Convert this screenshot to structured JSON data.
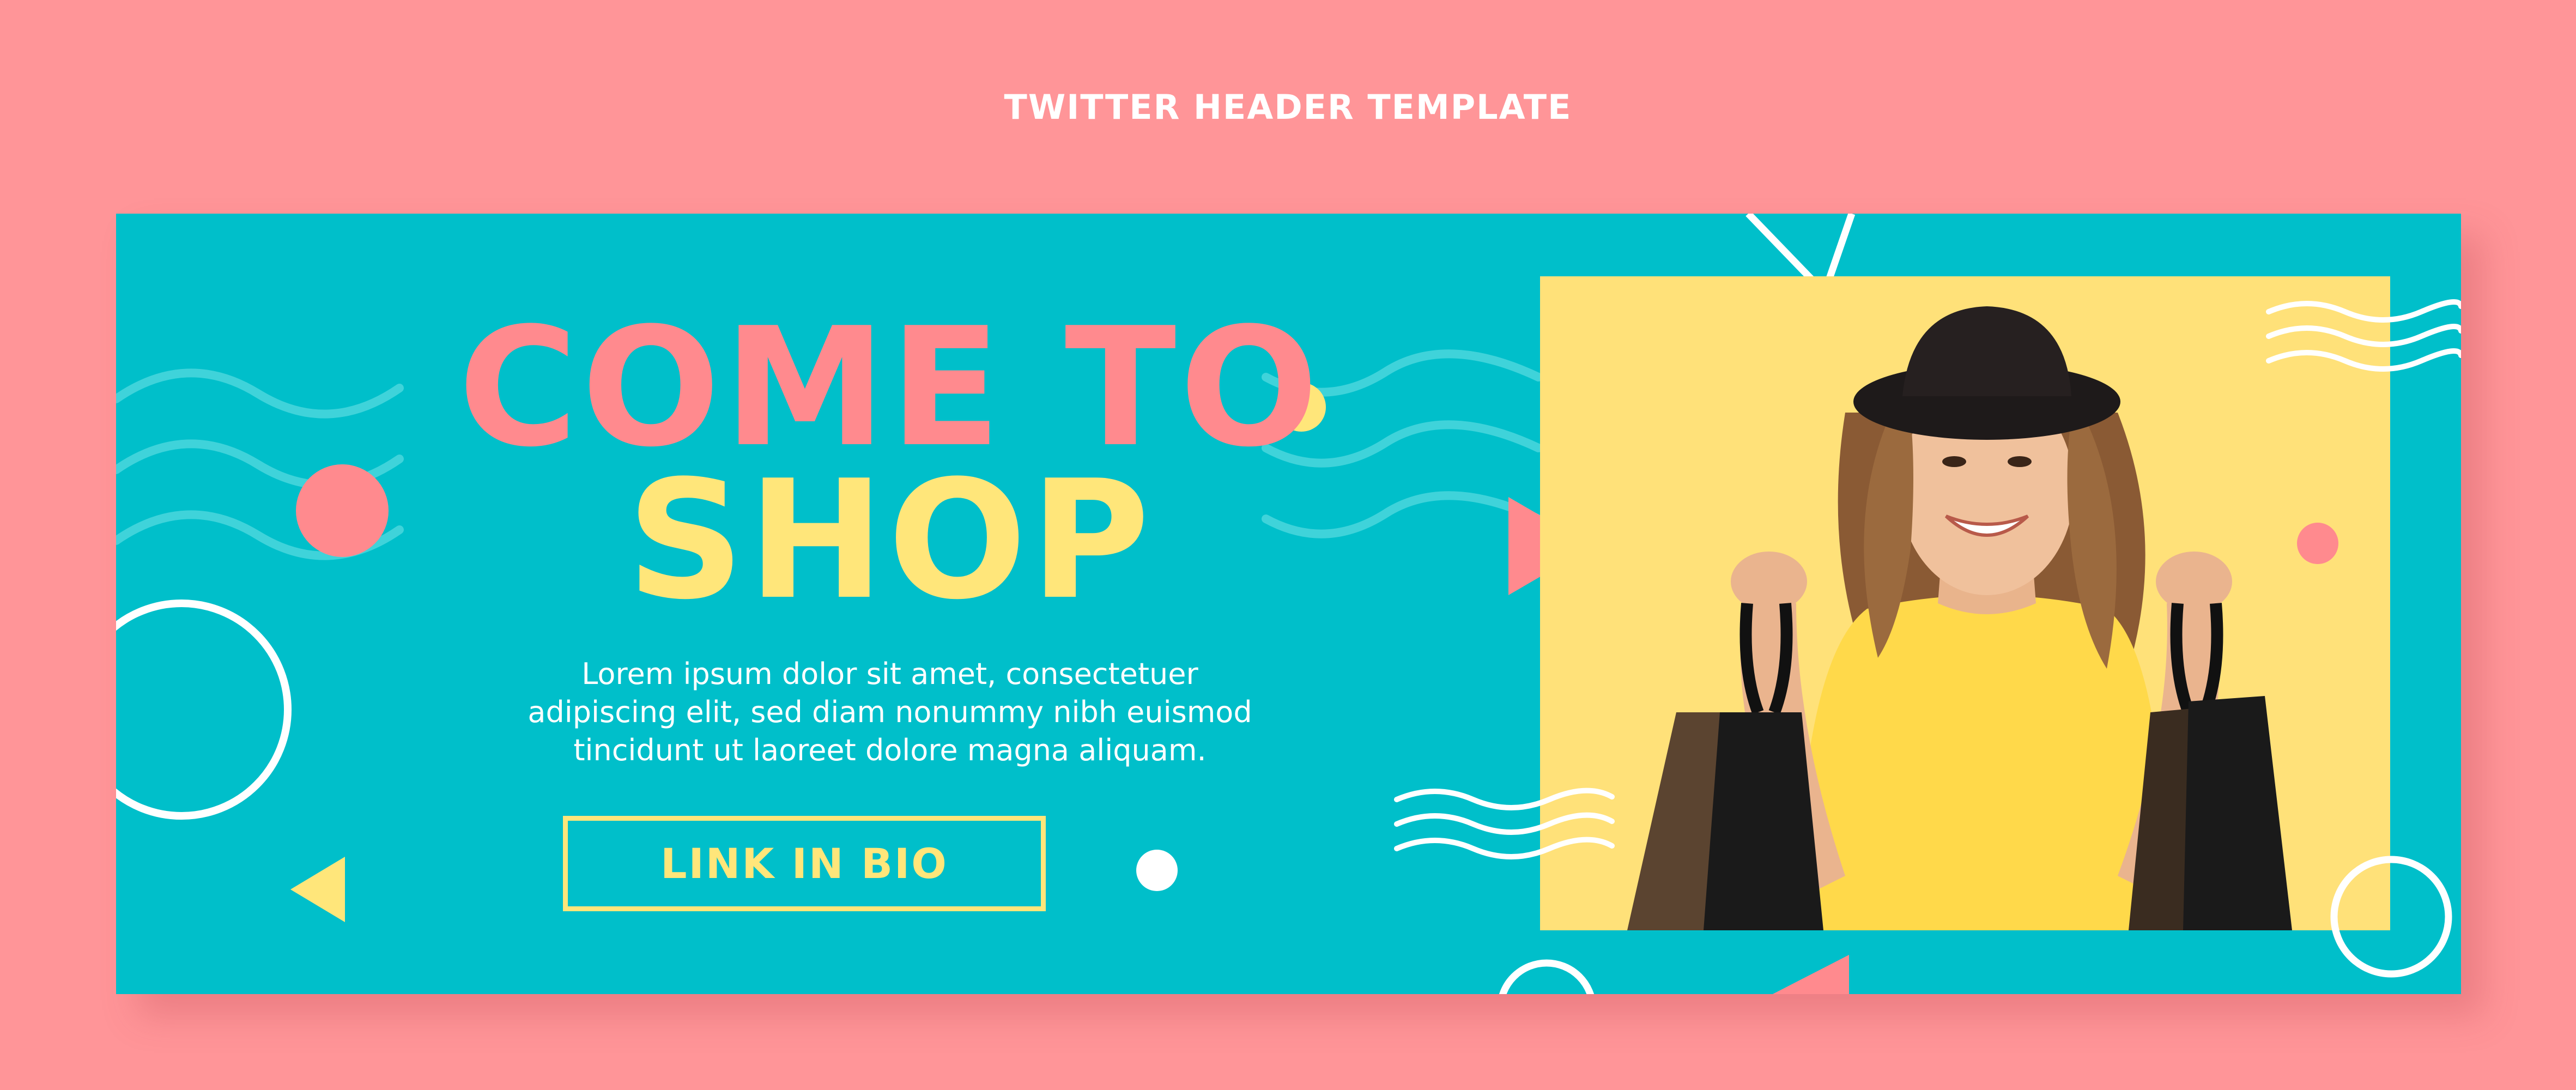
{
  "page_heading": "TWITTER HEADER TEMPLATE",
  "banner": {
    "headline_line1": "COME TO",
    "headline_line2": "SHOP",
    "body_lines": [
      "Lorem ipsum dolor sit amet, consectetuer",
      "adipiscing elit, sed diam nonummy nibh euismod",
      "tincidunt ut laoreet dolore magna aliquam."
    ],
    "cta_label": "LINK IN BIO"
  },
  "colors": {
    "page_background": "#ff9598",
    "banner_background": "#00bfca",
    "photo_background": "#ffe179",
    "accent_pink": "#ff8a8e",
    "accent_yellow": "#ffe67a",
    "text_white": "#ffffff"
  },
  "photo": {
    "subject": "smiling woman in a black hat holding black shopping bags"
  }
}
